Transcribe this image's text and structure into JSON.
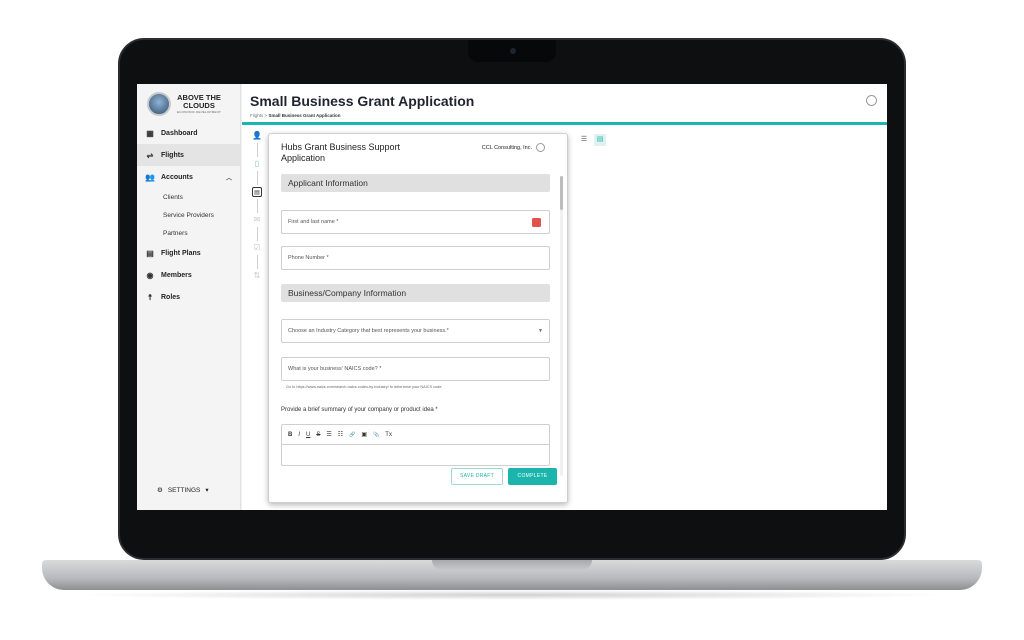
{
  "app": {
    "logo_line1": "ABOVE THE",
    "logo_line2": "CLOUDS",
    "logo_sub": "ECONOMIC DEVELOPMENT"
  },
  "sidebar": {
    "items": [
      {
        "label": "Dashboard",
        "icon": "dashboard-icon"
      },
      {
        "label": "Flights",
        "icon": "flights-icon",
        "active": true
      },
      {
        "label": "Accounts",
        "icon": "accounts-icon"
      },
      {
        "label": "Flight Plans",
        "icon": "flight-plans-icon"
      },
      {
        "label": "Members",
        "icon": "members-icon"
      },
      {
        "label": "Roles",
        "icon": "roles-icon"
      }
    ],
    "accounts_sub": [
      "Clients",
      "Service Providers",
      "Partners"
    ],
    "settings_label": "SETTINGS"
  },
  "header": {
    "title": "Small Business Grant Application",
    "breadcrumb_root": "Flights",
    "breadcrumb_sep": ">",
    "breadcrumb_current": "Small Business Grant Application"
  },
  "form": {
    "title": "Hubs Grant Business Support Application",
    "company": "CCL Consulting, Inc.",
    "section1": "Applicant Information",
    "name_placeholder": "First and last name *",
    "phone_placeholder": "Phone Number *",
    "section2": "Business/Company Information",
    "industry_placeholder": "Choose an Industry Category that best represents your business.*",
    "naics_placeholder": "What is your business' NAICS code? *",
    "naics_hint": "Go to https://www.naics.com/search-naics-codes-by-industry/ to determine your NAICS code.",
    "summary_label": "Provide a brief summary of your company or product idea *",
    "toolbar": [
      "B",
      "I",
      "U",
      "S",
      "☰",
      "☷",
      "🔗",
      "▣",
      "📎",
      "Tx"
    ],
    "save_draft": "SAVE DRAFT",
    "complete": "COMPLETE"
  },
  "colors": {
    "accent": "#1cb5ad",
    "calendar": "#e0524c"
  }
}
